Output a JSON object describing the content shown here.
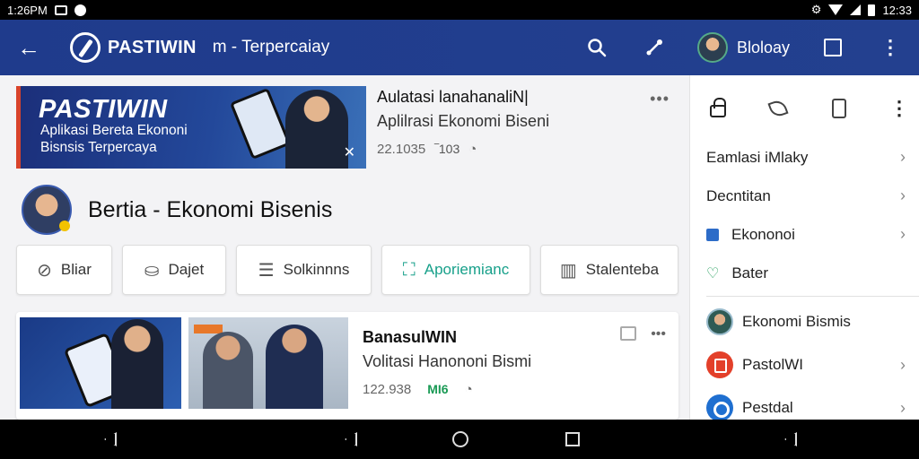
{
  "status_bar": {
    "time_left": "1:26PM",
    "time_right": "12:33"
  },
  "app_bar": {
    "logo_text": "PASTIWIN",
    "subtitle": "m - Terpercaiay",
    "profile_name": "Bloloay"
  },
  "banner": {
    "title": "PASTIWIN",
    "subtitle_line1": "Aplikasi Bereta Ekononi",
    "subtitle_line2": "Bisnsis Terpercaya"
  },
  "feature": {
    "title": "Aulatasi lanahanaliN|",
    "subtitle": "Aplilrasi Ekonomi Biseni",
    "meta_count": "22.1035",
    "meta_badge": "‾103"
  },
  "channel": {
    "title": "Bertia - Ekonomi Bisenis"
  },
  "chips": [
    {
      "label": "Bliar",
      "icon": "link-icon"
    },
    {
      "label": "Dajet",
      "icon": "bag-icon"
    },
    {
      "label": "Solkinnns",
      "icon": "document-icon"
    },
    {
      "label": "Aporiemianc",
      "icon": "briefcase-icon"
    },
    {
      "label": "Stalenteba",
      "icon": "bar-chart-icon"
    }
  ],
  "post": {
    "title": "BanasulWIN",
    "subtitle": "Volitasi Hanononi Bismi",
    "meta_count": "122.938",
    "badge": "MI6"
  },
  "side": {
    "items": [
      {
        "label": "Eamlasi iMlaky"
      },
      {
        "label": "Decntitan"
      },
      {
        "label": "Ekononoi"
      },
      {
        "label": "Bater"
      }
    ],
    "rich_items": [
      {
        "label": "Ekonomi Bismis"
      },
      {
        "label": "PastolWI"
      },
      {
        "label": "Pestdal"
      }
    ]
  },
  "colors": {
    "app_bar": "#1f3b8c",
    "accent_green": "#17a08a",
    "banner_red": "#d8432b"
  }
}
